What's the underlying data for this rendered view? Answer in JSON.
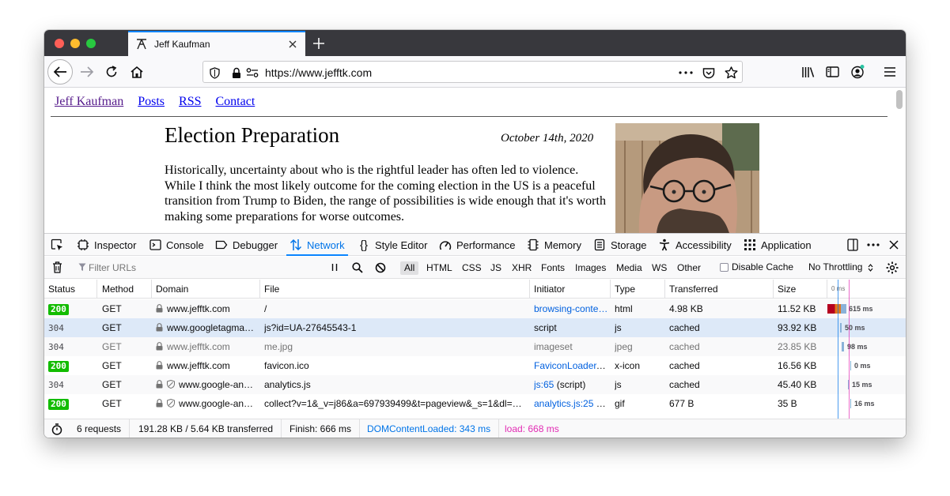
{
  "browser": {
    "tab_title": "Jeff Kaufman",
    "url": "https://www.jefftk.com"
  },
  "page": {
    "nav": [
      "Jeff Kaufman",
      "Posts",
      "RSS",
      "Contact"
    ],
    "title": "Election Preparation",
    "date": "October 14th, 2020",
    "body": "Historically, uncertainty about who is the rightful leader has often led to violence. While I think the most likely outcome for the coming election in the US is a peaceful transition from Trump to Biden, the range of possibilities is wide enough that it's worth making some preparations for worse outcomes."
  },
  "devtools": {
    "tabs": [
      "Inspector",
      "Console",
      "Debugger",
      "Network",
      "Style Editor",
      "Performance",
      "Memory",
      "Storage",
      "Accessibility",
      "Application"
    ],
    "active_tab": "Network",
    "filter_placeholder": "Filter URLs",
    "type_filters": [
      "All",
      "HTML",
      "CSS",
      "JS",
      "XHR",
      "Fonts",
      "Images",
      "Media",
      "WS",
      "Other"
    ],
    "disable_cache_label": "Disable Cache",
    "throttling": "No Throttling",
    "columns": [
      "Status",
      "Method",
      "Domain",
      "File",
      "Initiator",
      "Type",
      "Transferred",
      "Size"
    ],
    "waterfall_start": "0 ms",
    "rows": [
      {
        "status": "200",
        "method": "GET",
        "domain": "www.jefftk.com",
        "file": "/",
        "initiator": "browsing-conte…",
        "initiator_extra": "",
        "type": "html",
        "transferred": "4.98 KB",
        "size": "11.52 KB",
        "time": "615 ms",
        "dim": false
      },
      {
        "status": "304",
        "method": "GET",
        "domain": "www.googletagma…",
        "file": "js?id=UA-27645543-1",
        "initiator": "script",
        "initiator_extra": "",
        "type": "js",
        "transferred": "cached",
        "size": "93.92 KB",
        "time": "50 ms",
        "dim": false
      },
      {
        "status": "304",
        "method": "GET",
        "domain": "www.jefftk.com",
        "file": "me.jpg",
        "initiator": "imageset",
        "initiator_extra": "",
        "type": "jpeg",
        "transferred": "cached",
        "size": "23.85 KB",
        "time": "98 ms",
        "dim": true
      },
      {
        "status": "200",
        "method": "GET",
        "domain": "www.jefftk.com",
        "file": "favicon.ico",
        "initiator": "FaviconLoader.j…",
        "initiator_extra": "",
        "type": "x-icon",
        "transferred": "cached",
        "size": "16.56 KB",
        "time": "0 ms",
        "dim": false
      },
      {
        "status": "304",
        "method": "GET",
        "domain": "www.google-an…",
        "file": "analytics.js",
        "initiator": "js:65",
        "initiator_extra": " (script)",
        "type": "js",
        "transferred": "cached",
        "size": "45.40 KB",
        "time": "15 ms",
        "dim": false
      },
      {
        "status": "200",
        "method": "GET",
        "domain": "www.google-an…",
        "file": "collect?v=1&_v=j86&a=697939499&t=pageview&_s=1&dl=https",
        "initiator": "analytics.js:25",
        "initiator_extra": " (…",
        "type": "gif",
        "transferred": "677 B",
        "size": "35 B",
        "time": "16 ms",
        "dim": false
      }
    ],
    "summary": {
      "requests": "6 requests",
      "bytes": "191.28 KB / 5.64 KB transferred",
      "finish": "Finish: 666 ms",
      "dcl": "DOMContentLoaded: 343 ms",
      "load": "load: 668 ms"
    }
  }
}
